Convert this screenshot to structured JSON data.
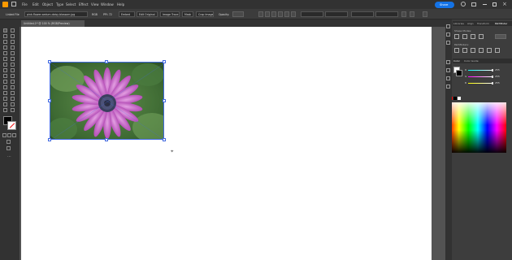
{
  "menu": {
    "app_icon": "illustrator-logo-icon",
    "items": [
      "File",
      "Edit",
      "Object",
      "Type",
      "Select",
      "Effect",
      "View",
      "Window",
      "Help"
    ],
    "share_label": "Share"
  },
  "control": {
    "selection_label": "Linked File",
    "filename": "pink-flower-sedum-daisy-blossom.jpg",
    "color_mode": "RGB",
    "ppi": "PPI: 72",
    "embed_label": "Embed",
    "edit_original": "Edit Original",
    "image_trace": "Image Trace",
    "mask_label": "Mask",
    "crop_label": "Crop Image",
    "opacity_label": "Opacity:"
  },
  "document": {
    "tab_title": "Untitled-1* @ 100 % (RGB/Preview)"
  },
  "panels": {
    "top_tabs": [
      "Libraries",
      "Align",
      "Transform",
      "Pathfinder"
    ],
    "shape_modes_label": "Shape Modes:",
    "pathfinders_label": "Pathfinders:",
    "color_tabs": [
      "Color",
      "Color Guide"
    ],
    "channels": [
      "R",
      "G",
      "B"
    ],
    "channel_values": [
      "255",
      "255",
      "255"
    ]
  },
  "colors": {
    "chrome": "#323232",
    "panel": "#3d3d3d",
    "canvas": "#ffffff",
    "selection": "#4169e1",
    "share": "#1473e6"
  }
}
